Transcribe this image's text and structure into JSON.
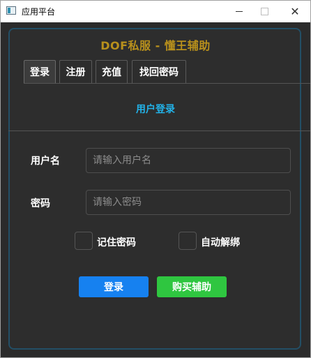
{
  "window": {
    "title": "应用平台"
  },
  "brand": {
    "title": "DOF私服 - 懂王辅助"
  },
  "tabs": [
    {
      "label": "登录",
      "active": true
    },
    {
      "label": "注册",
      "active": false
    },
    {
      "label": "充值",
      "active": false
    },
    {
      "label": "找回密码",
      "active": false
    }
  ],
  "login": {
    "section_title": "用户登录",
    "username_label": "用户名",
    "username_placeholder": "请输入用户名",
    "username_value": "",
    "password_label": "密码",
    "password_placeholder": "请输入密码",
    "password_value": "",
    "remember_label": "记住密码",
    "remember_checked": false,
    "autounbind_label": "自动解绑",
    "autounbind_checked": false,
    "login_button": "登录",
    "buy_button": "购买辅助"
  },
  "colors": {
    "brand": "#b8901c",
    "section_title": "#22b2e8",
    "login_button": "#1681f0",
    "buy_button": "#2fc640",
    "panel_border": "#234f66"
  }
}
